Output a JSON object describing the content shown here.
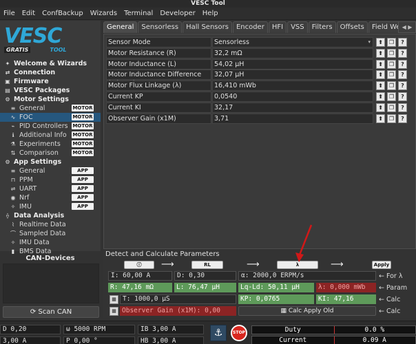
{
  "window_title": "VESC Tool",
  "menu": [
    "File",
    "Edit",
    "ConfBackup",
    "Wizards",
    "Terminal",
    "Developer",
    "Help"
  ],
  "logo": {
    "main": "VESC",
    "badge": "GRATIS",
    "sub": "TOOL"
  },
  "sidebar": {
    "items": [
      {
        "label": "Welcome & Wizards",
        "level": 0,
        "icon": "wand-icon"
      },
      {
        "label": "Connection",
        "level": 0,
        "icon": "connection-icon"
      },
      {
        "label": "Firmware",
        "level": 0,
        "icon": "chip-icon"
      },
      {
        "label": "VESC Packages",
        "level": 0,
        "icon": "package-icon"
      },
      {
        "label": "Motor Settings",
        "level": 0,
        "icon": "motor-icon"
      },
      {
        "label": "General",
        "level": 1,
        "icon": "sliders-icon",
        "tag": "MOTOR"
      },
      {
        "label": "FOC",
        "level": 1,
        "icon": "foc-icon",
        "tag": "MOTOR",
        "selected": true
      },
      {
        "label": "PID Controllers",
        "level": 1,
        "icon": "pid-icon",
        "tag": "MOTOR"
      },
      {
        "label": "Additional Info",
        "level": 1,
        "icon": "info-icon",
        "tag": "MOTOR"
      },
      {
        "label": "Experiments",
        "level": 1,
        "icon": "flask-icon",
        "tag": "MOTOR"
      },
      {
        "label": "Comparison",
        "level": 1,
        "icon": "compare-icon",
        "tag": "MOTOR"
      },
      {
        "label": "App Settings",
        "level": 0,
        "icon": "app-icon"
      },
      {
        "label": "General",
        "level": 1,
        "icon": "sliders-icon",
        "tag": "APP"
      },
      {
        "label": "PPM",
        "level": 1,
        "icon": "ppm-icon",
        "tag": "APP"
      },
      {
        "label": "UART",
        "level": 1,
        "icon": "uart-icon",
        "tag": "APP"
      },
      {
        "label": "Nrf",
        "level": 1,
        "icon": "wireless-icon",
        "tag": "APP"
      },
      {
        "label": "IMU",
        "level": 1,
        "icon": "imu-icon",
        "tag": "APP"
      },
      {
        "label": "Data Analysis",
        "level": 0,
        "icon": "analysis-icon"
      },
      {
        "label": "Realtime Data",
        "level": 1,
        "icon": "realtime-icon"
      },
      {
        "label": "Sampled Data",
        "level": 1,
        "icon": "sampled-icon"
      },
      {
        "label": "IMU Data",
        "level": 1,
        "icon": "imu-icon"
      },
      {
        "label": "BMS Data",
        "level": 1,
        "icon": "battery-icon"
      }
    ],
    "can_title": "CAN-Devices",
    "scan_button": "Scan CAN"
  },
  "tabs": [
    "General",
    "Sensorless",
    "Hall Sensors",
    "Encoder",
    "HFI",
    "VSS",
    "Filters",
    "Offsets",
    "Field Weakening"
  ],
  "active_tab": "General",
  "params": [
    {
      "name": "Sensor Mode",
      "value": "Sensorless",
      "dropdown": true
    },
    {
      "name": "Motor Resistance (R)",
      "value": "32,2 mΩ"
    },
    {
      "name": "Motor Inductance (L)",
      "value": "54,02 μH"
    },
    {
      "name": "Motor Inductance Difference (Ld - Lq)",
      "value": "32,07 μH"
    },
    {
      "name": "Motor Flux Linkage (λ)",
      "value": "16,410 mWb"
    },
    {
      "name": "Current KP",
      "value": "0,0540"
    },
    {
      "name": "Current KI",
      "value": "32,17"
    },
    {
      "name": "Observer Gain (x1M)",
      "value": "3,71"
    }
  ],
  "detect": {
    "title": "Detect and Calculate Parameters",
    "buttons": {
      "rl": "RL",
      "lambda": "λ",
      "apply": "Apply"
    },
    "i_field": "I: 60,00 A",
    "d_field": "D: 0,30",
    "alpha_field": "α: 2000,0 ERPM/s",
    "for_label": "← For λ",
    "r_field": "R: 47,16 mΩ",
    "l_field": "L: 76,47 μH",
    "lqld_field": "Lq-Ld: 50,11 μH",
    "lambda_field": "λ: 0,000 mWb",
    "param_label": "← Param",
    "t_field": "T: 1000,0 μS",
    "kp_field": "KP: 0,0765",
    "ki_field": "KI: 47,16",
    "calc_label": "← Calc",
    "obs_field": "Observer Gain (x1M): 0,00",
    "calc_apply_button": "Calc Apply Old",
    "calc_label2": "← Calc"
  },
  "status": {
    "d": "D 0,20",
    "omega": "ω 5000 RPM",
    "ib": "IB 3,00 A",
    "a": "3,00 A",
    "p": "P 0,00 °",
    "hb": "HB 3,00 A",
    "duty_label": "Duty",
    "duty_value": "0.0 %",
    "current_label": "Current",
    "current_value": "0.09 A"
  },
  "colors": {
    "accent": "#2fa8d8",
    "selected": "#26577e",
    "green": "#5e9a5a",
    "red": "#8c2424",
    "annotation": "#d01818"
  }
}
